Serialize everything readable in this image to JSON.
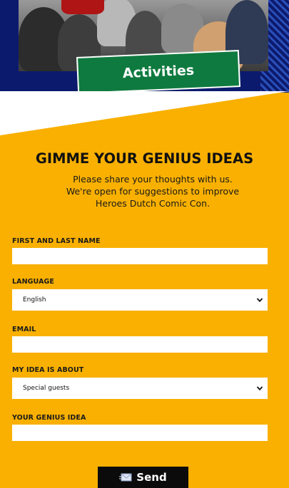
{
  "hero": {
    "activities_label": "Activities"
  },
  "form": {
    "title": "GIMME YOUR GENIUS IDEAS",
    "intro": "Please share your thoughts with us. We're open for suggestions to improve Heroes Dutch Comic Con.",
    "name": {
      "label": "FIRST AND LAST NAME",
      "value": ""
    },
    "language": {
      "label": "LANGUAGE",
      "selected": "English"
    },
    "email": {
      "label": "EMAIL",
      "value": ""
    },
    "topic": {
      "label": "MY IDEA IS ABOUT",
      "selected": "Special guests"
    },
    "idea": {
      "label": "YOUR GENIUS IDEA",
      "value": ""
    },
    "send_label": "Send"
  },
  "colors": {
    "background": "#f9b000",
    "activities_badge": "#0f7a3f",
    "hero": "#0c1a6d",
    "button": "#0b0b0b"
  },
  "icons": {
    "send": "envelope-icon",
    "select": "chevron-down-icon"
  }
}
